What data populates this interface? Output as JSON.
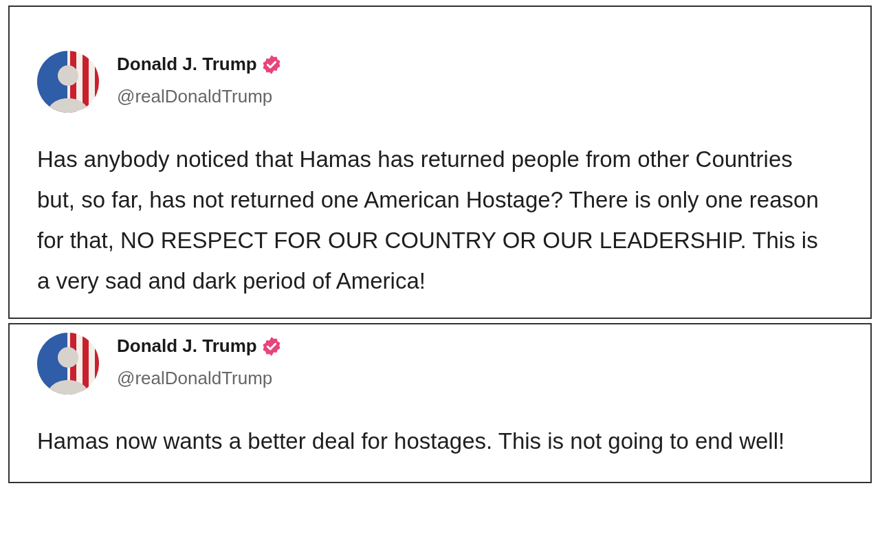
{
  "posts": [
    {
      "author": {
        "name": "Donald J. Trump",
        "handle": "@realDonaldTrump",
        "verified": true
      },
      "text": "Has anybody noticed that Hamas has returned people from other Countries but, so far, has not returned one American Hostage? There is only one reason for that, NO RESPECT FOR OUR COUNTRY OR OUR LEADERSHIP. This is a very sad and dark period of America!"
    },
    {
      "author": {
        "name": "Donald J. Trump",
        "handle": "@realDonaldTrump",
        "verified": true
      },
      "text": "Hamas now wants a better deal for hostages. This is not going to end well!"
    }
  ]
}
